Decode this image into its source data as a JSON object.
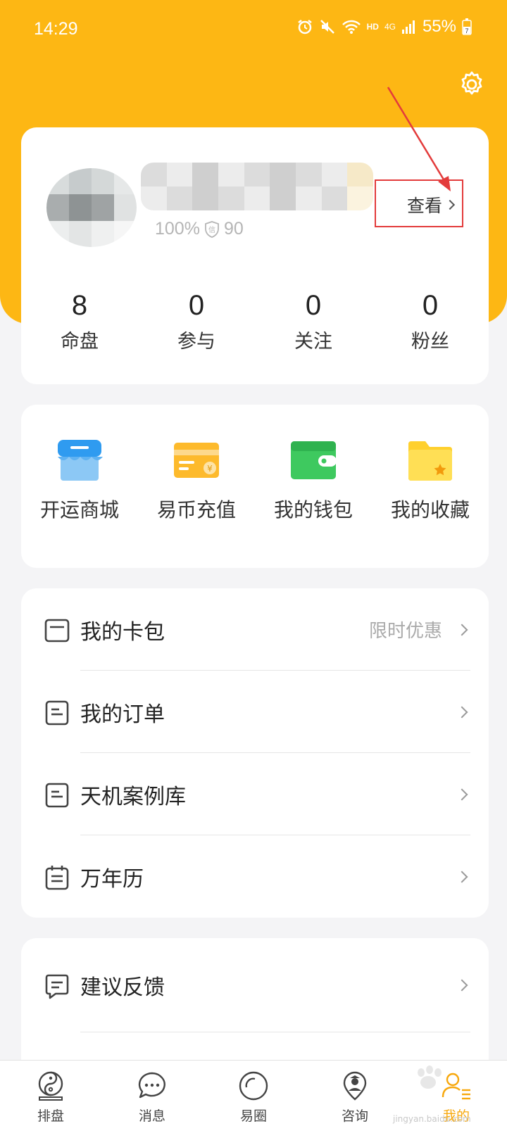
{
  "status_bar": {
    "time": "14:29",
    "hd": "HD",
    "net_type": "4G",
    "net_sub": "4G",
    "battery": "55%",
    "battery_badge": "7"
  },
  "profile": {
    "level_percent": "100%",
    "credit_badge": "信",
    "credit_score": "90",
    "view_label": "查看"
  },
  "stats": [
    {
      "value": "8",
      "label": "命盘"
    },
    {
      "value": "0",
      "label": "参与"
    },
    {
      "value": "0",
      "label": "关注"
    },
    {
      "value": "0",
      "label": "粉丝"
    }
  ],
  "shortcuts": [
    {
      "label": "开运商城",
      "icon": "store-icon"
    },
    {
      "label": "易币充值",
      "icon": "recharge-card-icon"
    },
    {
      "label": "我的钱包",
      "icon": "wallet-icon"
    },
    {
      "label": "我的收藏",
      "icon": "favorites-folder-icon"
    }
  ],
  "menu": [
    {
      "label": "我的卡包",
      "hint": "限时优惠",
      "icon": "card-pack-icon"
    },
    {
      "label": "我的订单",
      "hint": "",
      "icon": "order-icon"
    },
    {
      "label": "天机案例库",
      "hint": "",
      "icon": "case-library-icon"
    },
    {
      "label": "万年历",
      "hint": "",
      "icon": "calendar-icon"
    }
  ],
  "menu2": [
    {
      "label": "建议反馈",
      "hint": "",
      "icon": "feedback-icon"
    }
  ],
  "tabs": [
    {
      "label": "排盘",
      "icon": "taiji-icon"
    },
    {
      "label": "消息",
      "icon": "message-icon"
    },
    {
      "label": "易圈",
      "icon": "circle-icon"
    },
    {
      "label": "咨询",
      "icon": "consult-icon"
    },
    {
      "label": "我的",
      "icon": "profile-icon",
      "active": true
    }
  ],
  "watermark": {
    "text": "jingyan.baidu.com"
  },
  "colors": {
    "brand": "#fdb714",
    "active_tab": "#f7a80d",
    "annotation": "#e33b3b"
  }
}
